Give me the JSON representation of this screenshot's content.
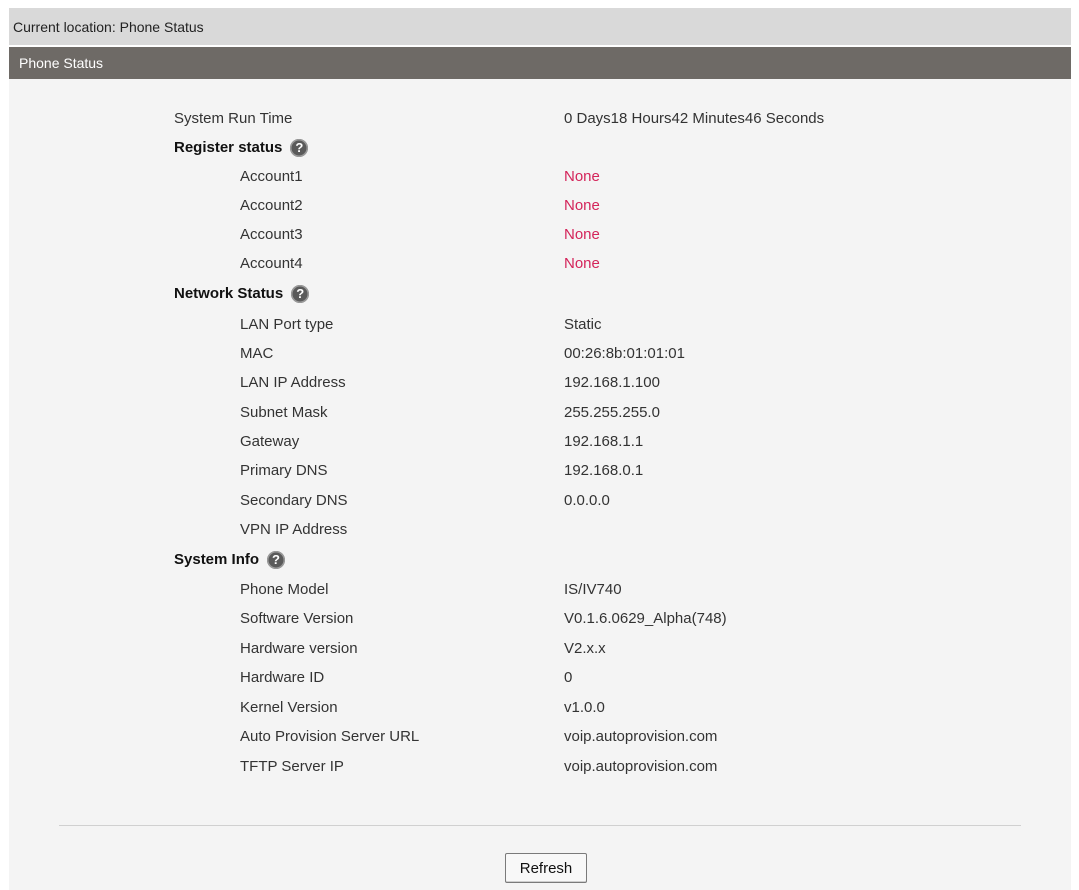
{
  "location": {
    "text": "Current location: Phone Status"
  },
  "section": {
    "title": "Phone Status"
  },
  "run_time": {
    "label": "System Run Time",
    "value": "0 Days18 Hours42 Minutes46 Seconds"
  },
  "register": {
    "title": "Register status",
    "help_icon": "question-circle-icon",
    "accounts": [
      {
        "label": "Account1",
        "value": "None"
      },
      {
        "label": "Account2",
        "value": "None"
      },
      {
        "label": "Account3",
        "value": "None"
      },
      {
        "label": "Account4",
        "value": "None"
      }
    ]
  },
  "network": {
    "title": "Network Status",
    "help_icon": "question-circle-icon",
    "rows": [
      {
        "label": "LAN Port type",
        "value": "Static"
      },
      {
        "label": "MAC",
        "value": "00:26:8b:01:01:01"
      },
      {
        "label": "LAN IP Address",
        "value": "192.168.1.100"
      },
      {
        "label": "Subnet Mask",
        "value": "255.255.255.0"
      },
      {
        "label": "Gateway",
        "value": "192.168.1.1"
      },
      {
        "label": "Primary DNS",
        "value": "192.168.0.1"
      },
      {
        "label": "Secondary DNS",
        "value": "0.0.0.0"
      },
      {
        "label": "VPN IP Address",
        "value": ""
      }
    ]
  },
  "system": {
    "title": "System Info",
    "help_icon": "question-circle-icon",
    "rows": [
      {
        "label": "Phone Model",
        "value": "IS/IV740"
      },
      {
        "label": "Software Version",
        "value": "V0.1.6.0629_Alpha(748)"
      },
      {
        "label": "Hardware version",
        "value": "V2.x.x"
      },
      {
        "label": "Hardware ID",
        "value": "0"
      },
      {
        "label": "Kernel Version",
        "value": "v1.0.0"
      },
      {
        "label": "Auto Provision Server URL",
        "value": "voip.autoprovision.com"
      },
      {
        "label": "TFTP Server IP",
        "value": "voip.autoprovision.com"
      }
    ]
  },
  "actions": {
    "refresh_label": "Refresh"
  },
  "colors": {
    "header_bg": "#6e6a66",
    "location_bg": "#d9d9d9",
    "status_none": "#d4245a"
  }
}
